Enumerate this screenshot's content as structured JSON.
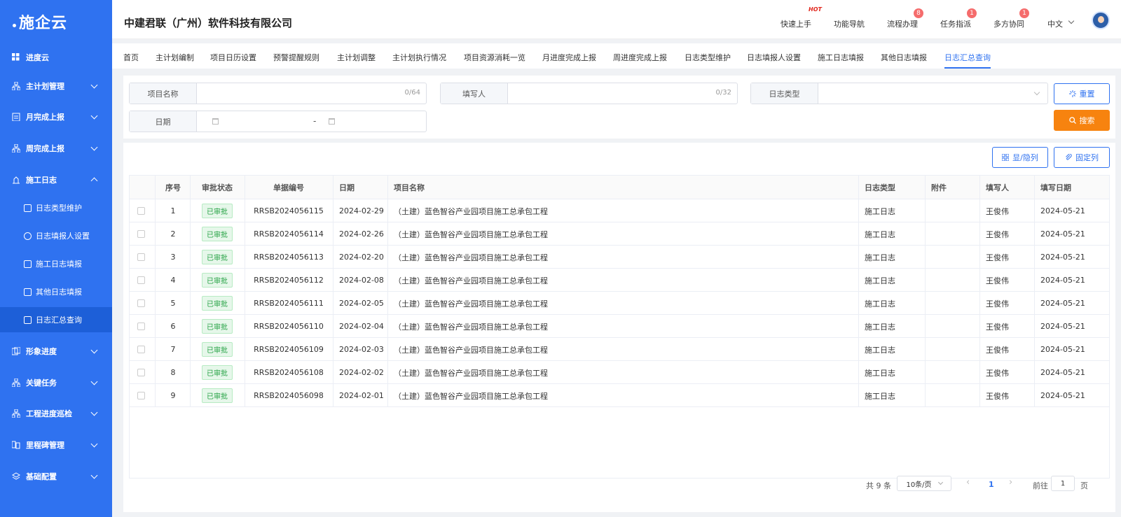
{
  "sidebar": {
    "logo": "施企云",
    "top_item": "进度云",
    "items": [
      {
        "label": "主计划管理",
        "icon": "hierarchy-icon"
      },
      {
        "label": "月完成上报",
        "icon": "clipboard-icon"
      },
      {
        "label": "周完成上报",
        "icon": "hierarchy-icon"
      },
      {
        "label": "施工日志",
        "icon": "construction-icon"
      },
      {
        "label": "形象进度",
        "icon": "stack-icon"
      },
      {
        "label": "关键任务",
        "icon": "hierarchy-icon"
      },
      {
        "label": "工程进度巡检",
        "icon": "hierarchy-icon"
      },
      {
        "label": "里程碑管理",
        "icon": "milestone-icon"
      },
      {
        "label": "基础配置",
        "icon": "layers-icon"
      }
    ],
    "sub_items": [
      {
        "label": "日志类型维护"
      },
      {
        "label": "日志填报人设置"
      },
      {
        "label": "施工日志填报"
      },
      {
        "label": "其他日志填报"
      },
      {
        "label": "日志汇总查询"
      }
    ]
  },
  "header": {
    "company": "中建君联（广州）软件科技有限公司",
    "links": [
      "快速上手",
      "功能导航",
      "流程办理",
      "任务指派",
      "多方协同"
    ],
    "hot_label": "HOT",
    "badges": {
      "flow": "8",
      "task": "1",
      "collab": "1"
    },
    "language": "中文"
  },
  "tabs": [
    "首页",
    "主计划编制",
    "项目日历设置",
    "预警提醒规则",
    "主计划调整",
    "主计划执行情况",
    "项目资源消耗一览",
    "月进度完成上报",
    "周进度完成上报",
    "日志类型维护",
    "日志填报人设置",
    "施工日志填报",
    "其他日志填报",
    "日志汇总查询"
  ],
  "filter": {
    "project_label": "项目名称",
    "project_count": "0/64",
    "writer_label": "填写人",
    "writer_count": "0/32",
    "type_label": "日志类型",
    "date_label": "日期",
    "date_sep": "-",
    "reset": "重置",
    "search": "搜索"
  },
  "table_actions": {
    "toggle_cols": "显/隐列",
    "fix_cols": "固定列"
  },
  "table": {
    "headers": [
      "序号",
      "审批状态",
      "单据编号",
      "日期",
      "项目名称",
      "日志类型",
      "附件",
      "填写人",
      "填写日期"
    ],
    "rows": [
      {
        "no": "1",
        "status": "已审批",
        "code": "RRSB2024056115",
        "date": "2024-02-29",
        "project": "（土建）蓝色智谷产业园项目施工总承包工程",
        "type": "施工日志",
        "attach": "",
        "writer": "王俊伟",
        "fill_date": "2024-05-21"
      },
      {
        "no": "2",
        "status": "已审批",
        "code": "RRSB2024056114",
        "date": "2024-02-26",
        "project": "（土建）蓝色智谷产业园项目施工总承包工程",
        "type": "施工日志",
        "attach": "",
        "writer": "王俊伟",
        "fill_date": "2024-05-21"
      },
      {
        "no": "3",
        "status": "已审批",
        "code": "RRSB2024056113",
        "date": "2024-02-20",
        "project": "（土建）蓝色智谷产业园项目施工总承包工程",
        "type": "施工日志",
        "attach": "",
        "writer": "王俊伟",
        "fill_date": "2024-05-21"
      },
      {
        "no": "4",
        "status": "已审批",
        "code": "RRSB2024056112",
        "date": "2024-02-08",
        "project": "（土建）蓝色智谷产业园项目施工总承包工程",
        "type": "施工日志",
        "attach": "",
        "writer": "王俊伟",
        "fill_date": "2024-05-21"
      },
      {
        "no": "5",
        "status": "已审批",
        "code": "RRSB2024056111",
        "date": "2024-02-05",
        "project": "（土建）蓝色智谷产业园项目施工总承包工程",
        "type": "施工日志",
        "attach": "",
        "writer": "王俊伟",
        "fill_date": "2024-05-21"
      },
      {
        "no": "6",
        "status": "已审批",
        "code": "RRSB2024056110",
        "date": "2024-02-04",
        "project": "（土建）蓝色智谷产业园项目施工总承包工程",
        "type": "施工日志",
        "attach": "",
        "writer": "王俊伟",
        "fill_date": "2024-05-21"
      },
      {
        "no": "7",
        "status": "已审批",
        "code": "RRSB2024056109",
        "date": "2024-02-03",
        "project": "（土建）蓝色智谷产业园项目施工总承包工程",
        "type": "施工日志",
        "attach": "",
        "writer": "王俊伟",
        "fill_date": "2024-05-21"
      },
      {
        "no": "8",
        "status": "已审批",
        "code": "RRSB2024056108",
        "date": "2024-02-02",
        "project": "（土建）蓝色智谷产业园项目施工总承包工程",
        "type": "施工日志",
        "attach": "",
        "writer": "王俊伟",
        "fill_date": "2024-05-21"
      },
      {
        "no": "9",
        "status": "已审批",
        "code": "RRSB2024056098",
        "date": "2024-02-01",
        "project": "（土建）蓝色智谷产业园项目施工总承包工程",
        "type": "施工日志",
        "attach": "",
        "writer": "王俊伟",
        "fill_date": "2024-05-21"
      }
    ]
  },
  "pagination": {
    "total": "共 9 条",
    "page_size": "10条/页",
    "current": "1",
    "goto_label": "前往",
    "goto_value": "1",
    "page_unit": "页"
  },
  "colors": {
    "primary": "#2f72f0",
    "search": "#f7830f",
    "approved": "#25a244",
    "badge": "#f56c6c"
  }
}
